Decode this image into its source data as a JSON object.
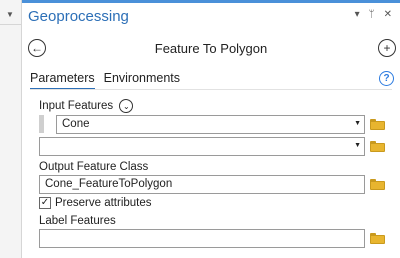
{
  "pane": {
    "title": "Geoprocessing",
    "tool_name": "Feature To Polygon",
    "controls": {
      "menu": "▾",
      "pin": "ᛘ",
      "close": "✕"
    }
  },
  "tabs": [
    {
      "label": "Parameters",
      "active": true
    },
    {
      "label": "Environments",
      "active": false
    }
  ],
  "params": {
    "input_features": {
      "label": "Input Features",
      "rows": [
        {
          "value": "Cone"
        },
        {
          "value": ""
        }
      ]
    },
    "output_feature_class": {
      "label": "Output Feature Class",
      "value": "Cone_FeatureToPolygon"
    },
    "preserve_attributes": {
      "label": "Preserve attributes",
      "checked": true,
      "check_glyph": "✓"
    },
    "label_features": {
      "label": "Label Features",
      "value": ""
    }
  },
  "icons": {
    "back": "arrow-left-icon",
    "add": "plus-icon",
    "help": "help-icon",
    "folder": "folder-icon",
    "info": "chevron-down-icon",
    "dropdown": "caret-down-icon"
  },
  "colors": {
    "accent": "#2c6fb7",
    "header_bar": "#4a90d9",
    "help": "#2c7be0",
    "folder": "#e8b52f"
  }
}
